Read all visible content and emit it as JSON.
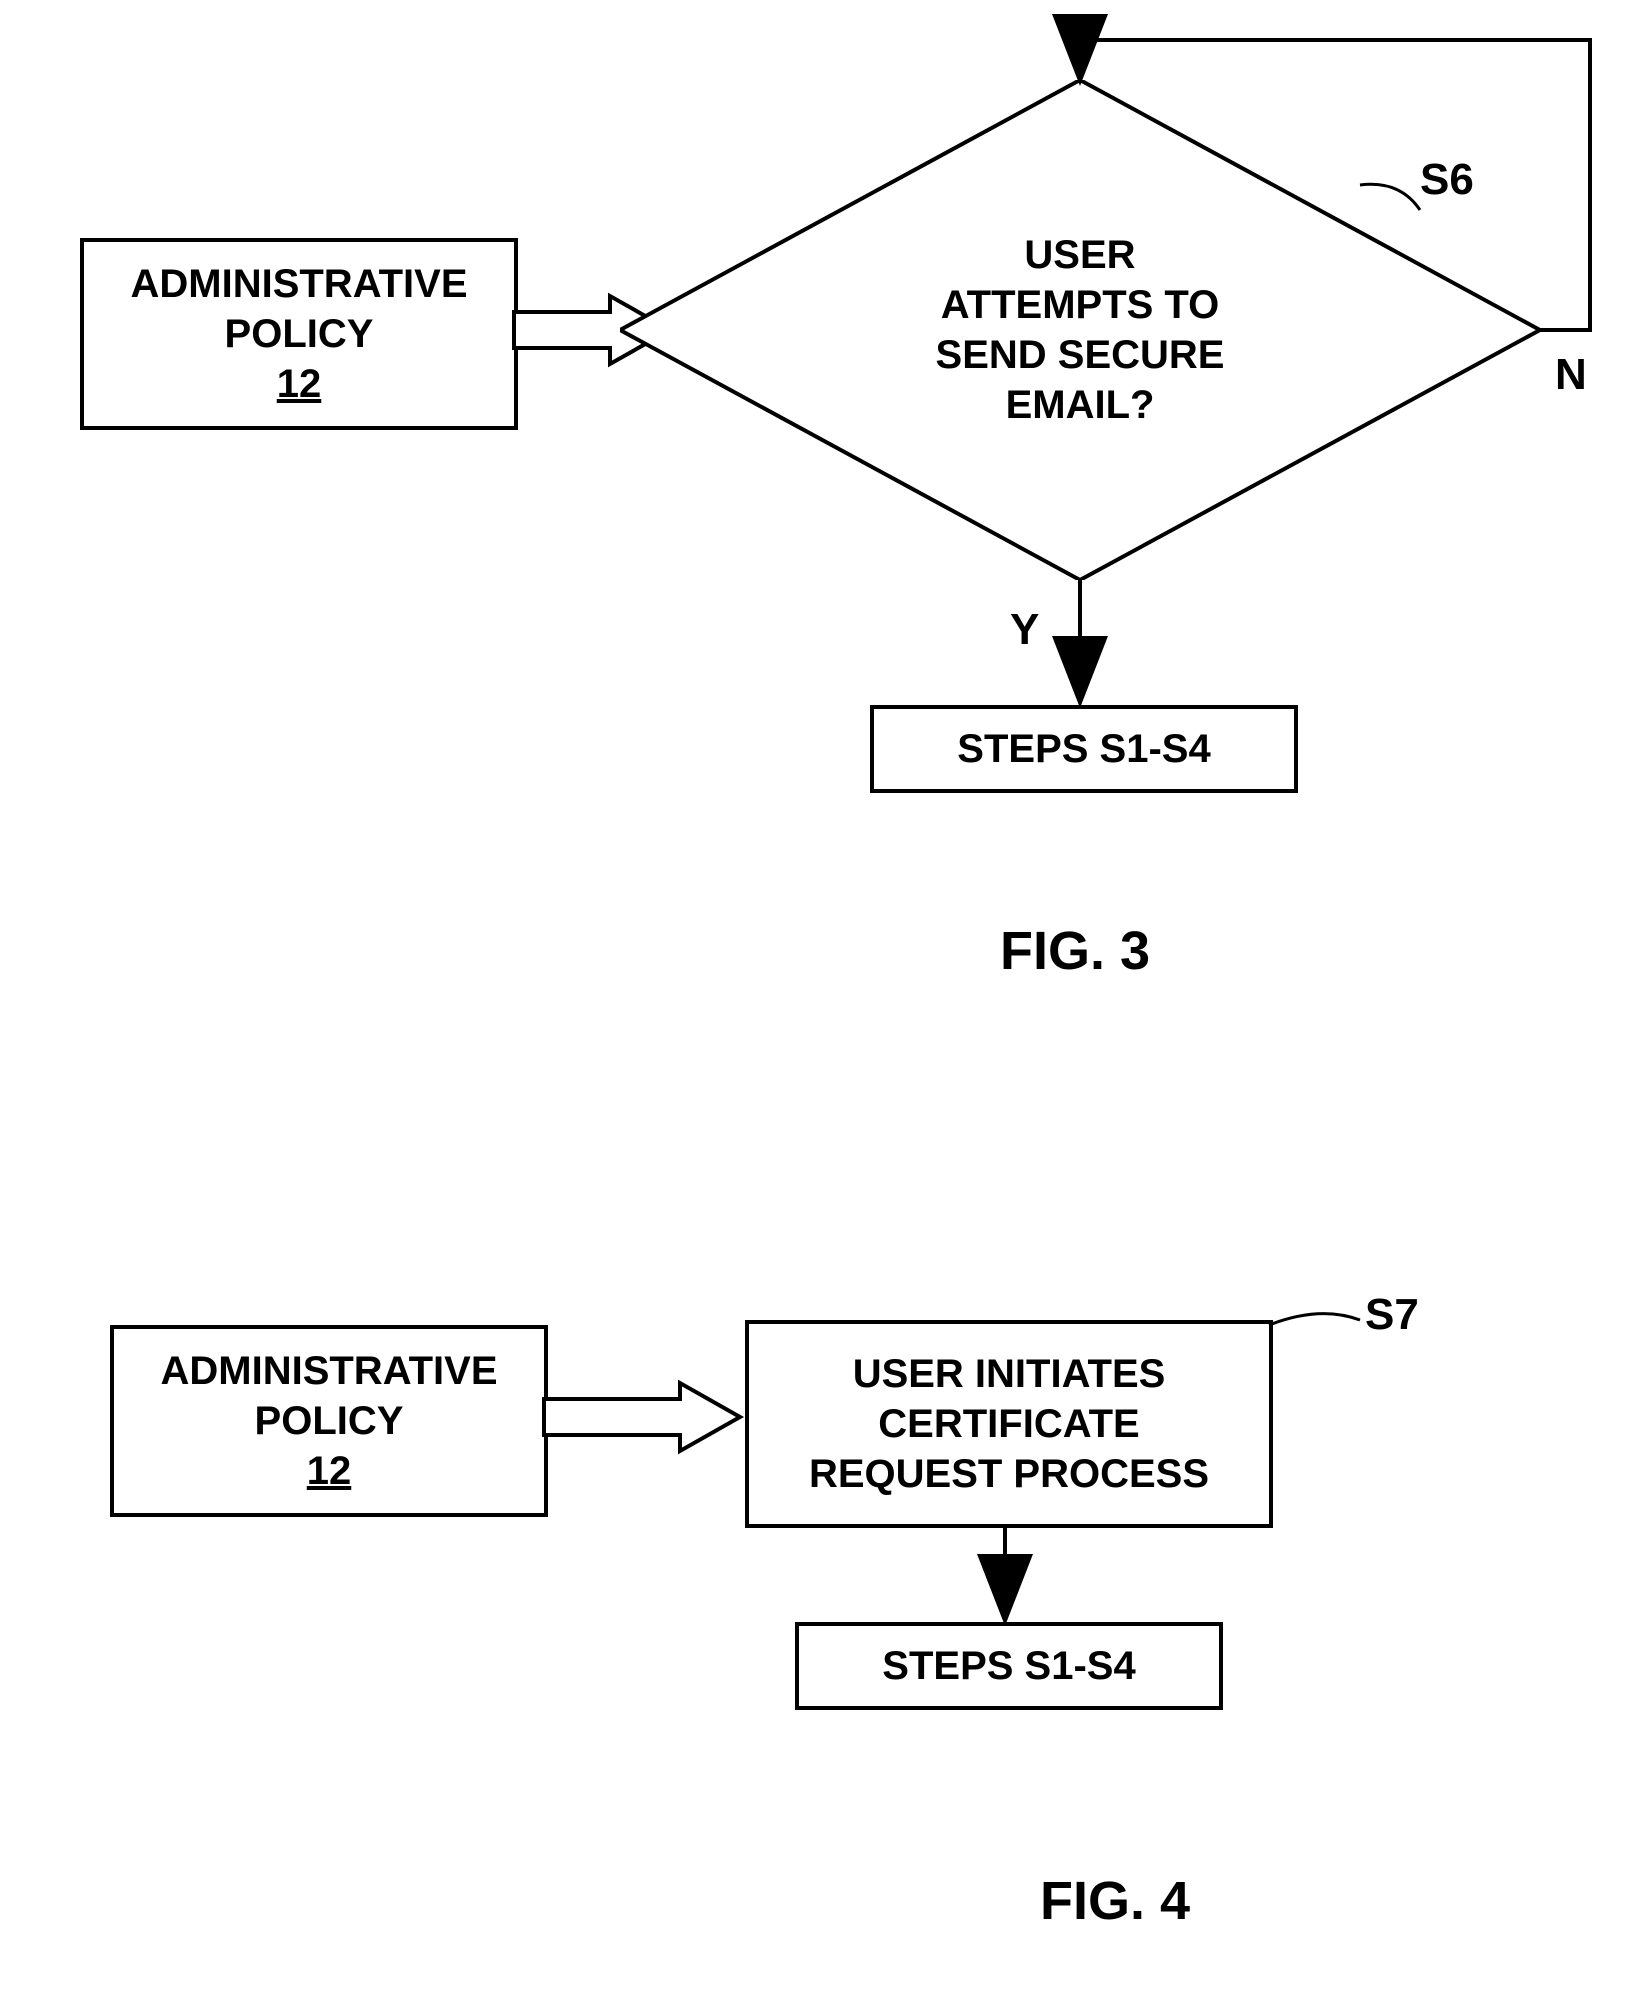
{
  "fig3": {
    "admin_box": {
      "line1": "ADMINISTRATIVE",
      "line2": "POLICY",
      "num": "12"
    },
    "decision": {
      "line1": "USER",
      "line2": "ATTEMPTS TO",
      "line3": "SEND SECURE",
      "line4": "EMAIL?"
    },
    "decision_label": "S6",
    "yes_label": "Y",
    "no_label": "N",
    "steps_box": "STEPS S1-S4",
    "caption": "FIG. 3"
  },
  "fig4": {
    "admin_box": {
      "line1": "ADMINISTRATIVE",
      "line2": "POLICY",
      "num": "12"
    },
    "process_box": {
      "line1": "USER INITIATES",
      "line2": "CERTIFICATE",
      "line3": "REQUEST PROCESS"
    },
    "process_label": "S7",
    "steps_box": "STEPS S1-S4",
    "caption": "FIG. 4"
  },
  "chart_data": [
    {
      "type": "flowchart",
      "figure": "FIG. 3",
      "nodes": [
        {
          "id": "admin3",
          "type": "input",
          "text": "ADMINISTRATIVE POLICY 12"
        },
        {
          "id": "S6",
          "type": "decision",
          "text": "USER ATTEMPTS TO SEND SECURE EMAIL?",
          "label": "S6"
        },
        {
          "id": "steps3",
          "type": "process",
          "text": "STEPS S1-S4"
        }
      ],
      "edges": [
        {
          "from": "admin3",
          "to": "S6",
          "style": "block-arrow"
        },
        {
          "from": "S6",
          "to": "steps3",
          "label": "Y"
        },
        {
          "from": "S6",
          "to": "S6",
          "label": "N",
          "loop": true
        }
      ]
    },
    {
      "type": "flowchart",
      "figure": "FIG. 4",
      "nodes": [
        {
          "id": "admin4",
          "type": "input",
          "text": "ADMINISTRATIVE POLICY 12"
        },
        {
          "id": "S7",
          "type": "process",
          "text": "USER INITIATES CERTIFICATE REQUEST PROCESS",
          "label": "S7"
        },
        {
          "id": "steps4",
          "type": "process",
          "text": "STEPS S1-S4"
        }
      ],
      "edges": [
        {
          "from": "admin4",
          "to": "S7",
          "style": "block-arrow"
        },
        {
          "from": "S7",
          "to": "steps4"
        }
      ]
    }
  ]
}
